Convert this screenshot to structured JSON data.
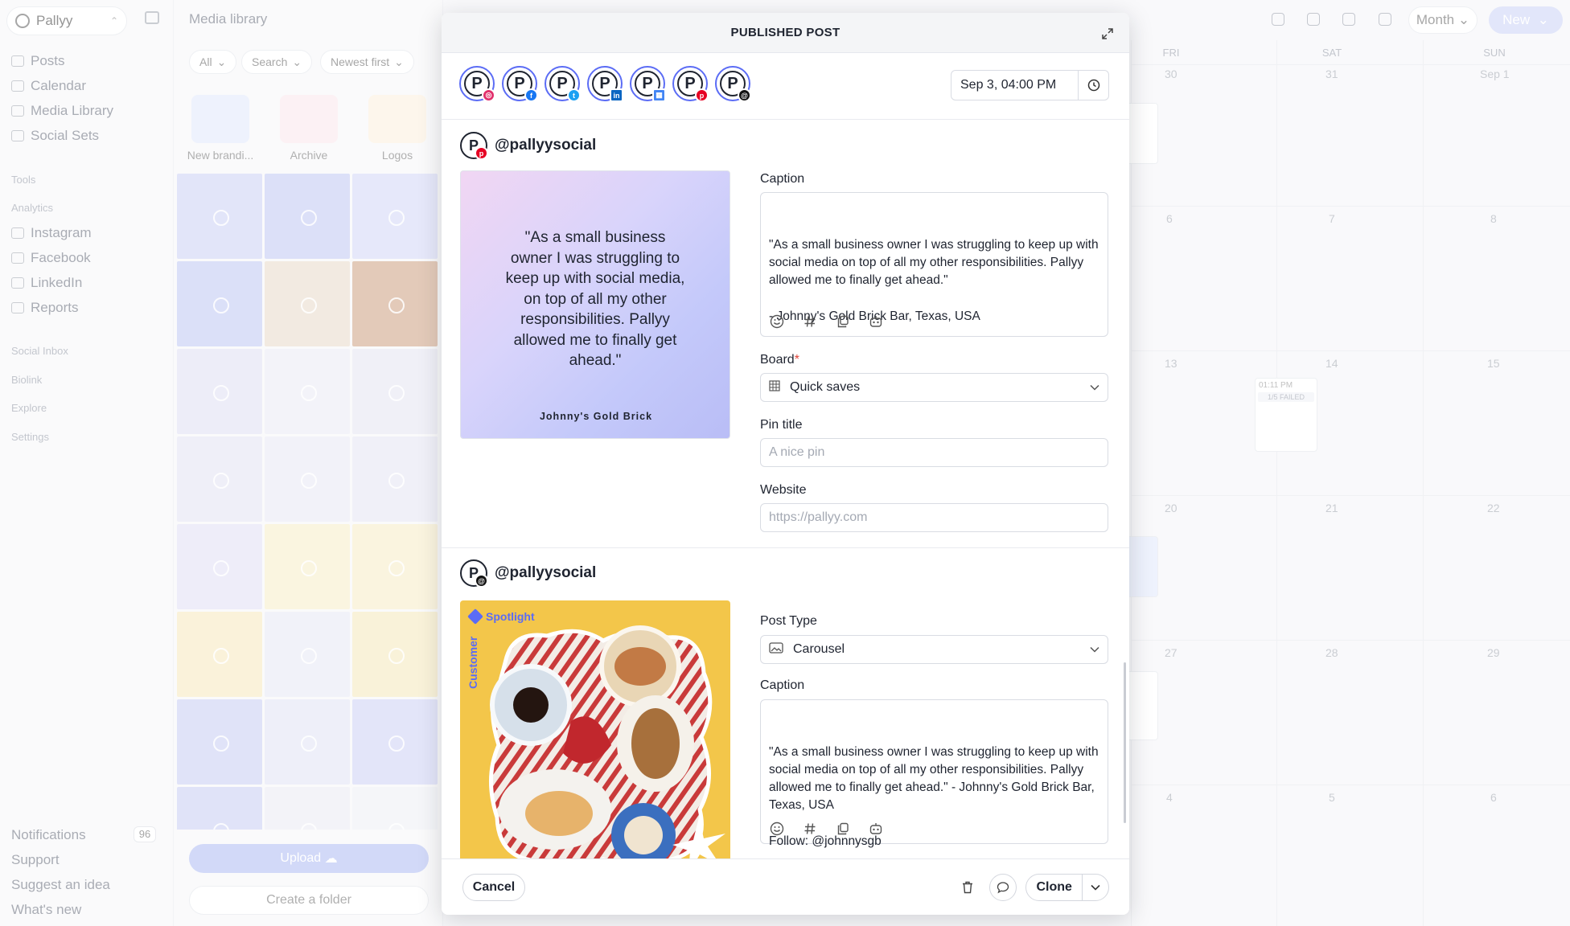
{
  "workspace": {
    "name": "Pallyy"
  },
  "sidebar": {
    "items": [
      {
        "label": "Posts"
      },
      {
        "label": "Calendar"
      },
      {
        "label": "Media Library"
      },
      {
        "label": "Social Sets"
      }
    ],
    "sections": {
      "tools": "Tools",
      "analytics": "Analytics",
      "social_inbox": "Social Inbox",
      "biolink": "Biolink",
      "explore": "Explore",
      "settings": "Settings"
    },
    "analytics_items": [
      {
        "label": "Instagram"
      },
      {
        "label": "Facebook"
      },
      {
        "label": "LinkedIn"
      },
      {
        "label": "Reports"
      }
    ],
    "bottom": {
      "notifications": "Notifications",
      "notifications_count": "96",
      "support": "Support",
      "suggest": "Suggest an idea",
      "whats_new": "What's new"
    }
  },
  "media_library": {
    "title": "Media library",
    "filters": {
      "all": "All",
      "search": "Search",
      "sort": "Newest first"
    },
    "folders": [
      {
        "label": "New brandi..."
      },
      {
        "label": "Archive"
      },
      {
        "label": "Logos"
      }
    ],
    "upload": "Upload",
    "create_folder": "Create a folder"
  },
  "calendar": {
    "view": "Month",
    "new": "New",
    "days": [
      "FRI",
      "SAT",
      "SUN"
    ],
    "weeks": [
      [
        "30",
        "31",
        "Sep 1"
      ],
      [
        "6",
        "7",
        "8"
      ],
      [
        "13",
        "14",
        "15"
      ],
      [
        "20",
        "21",
        "22"
      ],
      [
        "27",
        "28",
        "29"
      ],
      [
        "4",
        "5",
        "6"
      ]
    ],
    "event": {
      "time": "01:11 PM",
      "status": "1/5 FAILED"
    }
  },
  "modal": {
    "title": "PUBLISHED POST",
    "date": "Sep 3, 04:00 PM",
    "accounts": [
      {
        "network": "instagram",
        "color": "#e1306c"
      },
      {
        "network": "facebook",
        "color": "#1877f2"
      },
      {
        "network": "twitter",
        "color": "#1da1f2"
      },
      {
        "network": "linkedin",
        "color": "#0a66c2"
      },
      {
        "network": "google-business",
        "color": "#4285f4"
      },
      {
        "network": "pinterest",
        "color": "#e60023"
      },
      {
        "network": "threads",
        "color": "#111111"
      }
    ],
    "pinterest": {
      "handle": "@pallyysocial",
      "image_quote": "\"As a small business owner I was struggling to keep up with social media, on top of all my other responsibilities. Pallyy allowed me to finally get ahead.\"",
      "image_signature": "Johnny's Gold Brick",
      "caption_label": "Caption",
      "caption": "\"As a small business owner I was struggling to keep up with social media on top of all my other responsibilities. Pallyy allowed me to finally get ahead.\"\n\n- Johnny's Gold Brick Bar, Texas, USA",
      "board_label": "Board",
      "board_required": "*",
      "board_value": "Quick saves",
      "pin_title_label": "Pin title",
      "pin_title_placeholder": "A nice pin",
      "website_label": "Website",
      "website_placeholder": "https://pallyy.com"
    },
    "threads": {
      "handle": "@pallyysocial",
      "image_tag": "Spotlight",
      "image_side_tag": "Customer",
      "post_type_label": "Post Type",
      "post_type_value": "Carousel",
      "caption_label": "Caption",
      "caption": "\"As a small business owner I was struggling to keep up with social media on top of all my other responsibilities. Pallyy allowed me to finally get ahead.\" - Johnny's Gold Brick Bar, Texas, USA\n\nFollow: @johnnysgb"
    },
    "footer": {
      "cancel": "Cancel",
      "clone": "Clone"
    }
  }
}
